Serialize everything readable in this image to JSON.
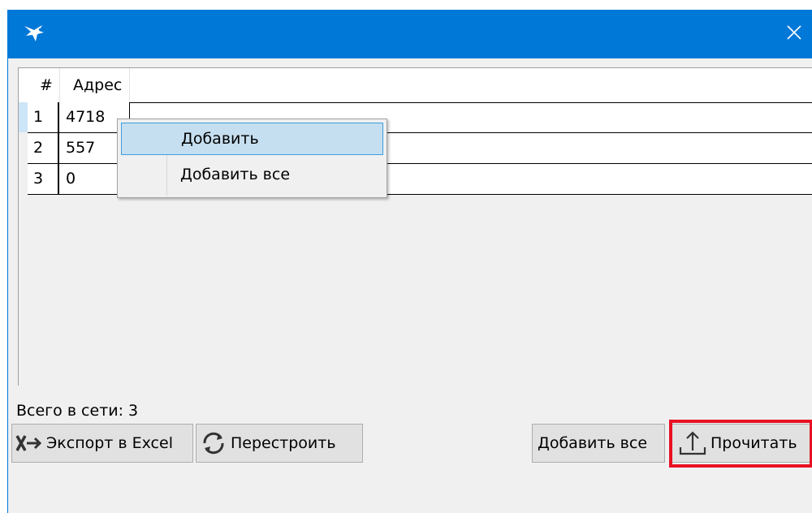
{
  "window": {
    "title": "",
    "icons": {
      "app": "bird-icon",
      "close": "close-icon"
    },
    "colors": {
      "titlebar": "#0078d7",
      "highlight_border": "#e81123",
      "menu_selected": "#c6dff0"
    }
  },
  "grid": {
    "columns": [
      "#",
      "Адрес"
    ],
    "rows": [
      {
        "num": "1",
        "address": "4718"
      },
      {
        "num": "2",
        "address": "557"
      },
      {
        "num": "3",
        "address": "0"
      }
    ]
  },
  "context_menu": {
    "items": [
      "Добавить",
      "Добавить все"
    ],
    "selected_index": 0
  },
  "status": {
    "total": "Всего в сети: 3"
  },
  "buttons": {
    "export": {
      "label": "Экспорт в Excel",
      "icon": "excel-export-icon"
    },
    "rebuild": {
      "label": "Перестроить",
      "icon": "refresh-icon"
    },
    "add_all": {
      "label": "Добавить все"
    },
    "read": {
      "label": "Прочитать",
      "icon": "upload-icon"
    }
  }
}
